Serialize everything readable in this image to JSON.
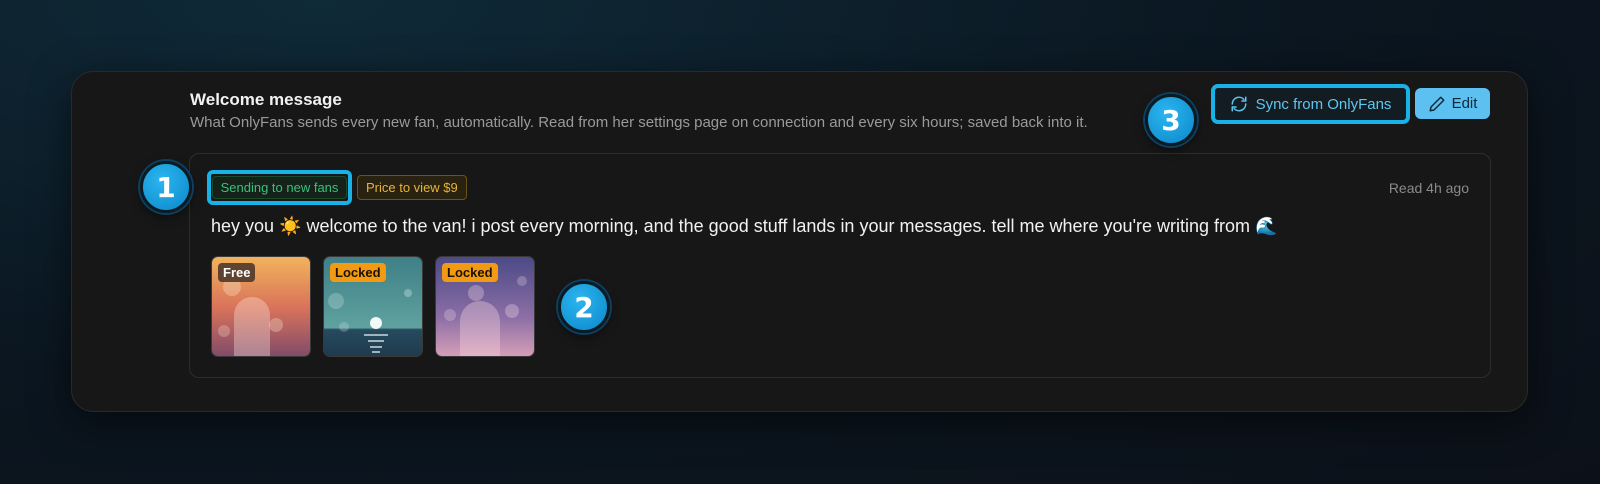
{
  "section": {
    "title": "Welcome message",
    "description": "What OnlyFans sends every new fan, automatically. Read from her settings page on connection and every six hours; saved back into it."
  },
  "actions": {
    "sync_label": "Sync from OnlyFans",
    "sync_icon": "refresh-icon",
    "edit_label": "Edit",
    "edit_icon": "pencil-icon"
  },
  "message": {
    "status_badge": "Sending to new fans",
    "price_badge": "Price to view $9",
    "read_time": "Read 4h ago",
    "text": "hey you ☀️ welcome to the van! i post every morning, and the good stuff lands in your messages. tell me where you're writing from 🌊",
    "media": [
      {
        "tag": "Free",
        "kind": "sunset-arch"
      },
      {
        "tag": "Locked",
        "kind": "sea-moon"
      },
      {
        "tag": "Locked",
        "kind": "purple-arch"
      }
    ]
  },
  "markers": [
    "1",
    "2",
    "3"
  ],
  "colors": {
    "accent": "#19b2e6",
    "edit_button": "#5cc0f0",
    "sending_green": "#37c27a",
    "price_amber": "#e6b43a",
    "locked_orange": "#f29a12"
  }
}
